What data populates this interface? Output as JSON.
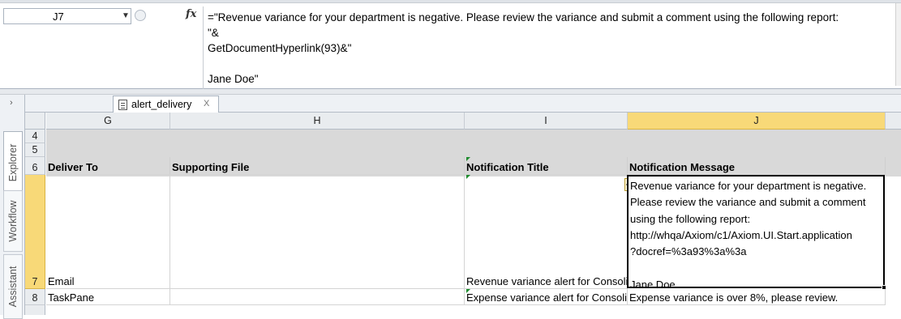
{
  "formula_bar": {
    "name_box": "J7",
    "fx_label": "fx",
    "formula": "=\"Revenue variance for your department is negative. Please review the variance and submit a comment using the following report:\n\"&\nGetDocumentHyperlink(93)&\"\n\nJane Doe\""
  },
  "task_pane": {
    "collapse_glyph": "›",
    "tabs": [
      "Explorer",
      "Workflow",
      "Assistant"
    ]
  },
  "document_tab": {
    "title": "alert_delivery",
    "close_glyph": "X",
    "icon": "document-icon"
  },
  "columns": [
    "G",
    "H",
    "I",
    "J"
  ],
  "rows": {
    "4": "4",
    "5": "5",
    "6": "6",
    "7": "7",
    "8": "8"
  },
  "headers": {
    "deliver_to": "Deliver To",
    "supporting_file": "Supporting File",
    "notification_title": "Notification Title",
    "notification_message": "Notification Message"
  },
  "data_rows": [
    {
      "row": "7",
      "deliver_to": "Email",
      "supporting_file": "",
      "notification_title": "Revenue variance alert for Consolidated Plan Code",
      "notification_message": "Revenue variance for your department is negative.\nPlease review the variance and submit a comment\nusing the following report:\nhttp://whqa/Axiom/c1/Axiom.UI.Start.application\n?docref=%3a93%3a%3a\n\nJane Doe"
    },
    {
      "row": "8",
      "deliver_to": "TaskPane",
      "supporting_file": "",
      "notification_title": "Expense variance alert for Consolidated Plan Code",
      "notification_message": "Expense variance is over 8%, please review."
    }
  ],
  "colors": {
    "selection_highlight": "#f8d978",
    "header_band": "#d9d9d9",
    "error_triangle": "#1e8c2e"
  }
}
